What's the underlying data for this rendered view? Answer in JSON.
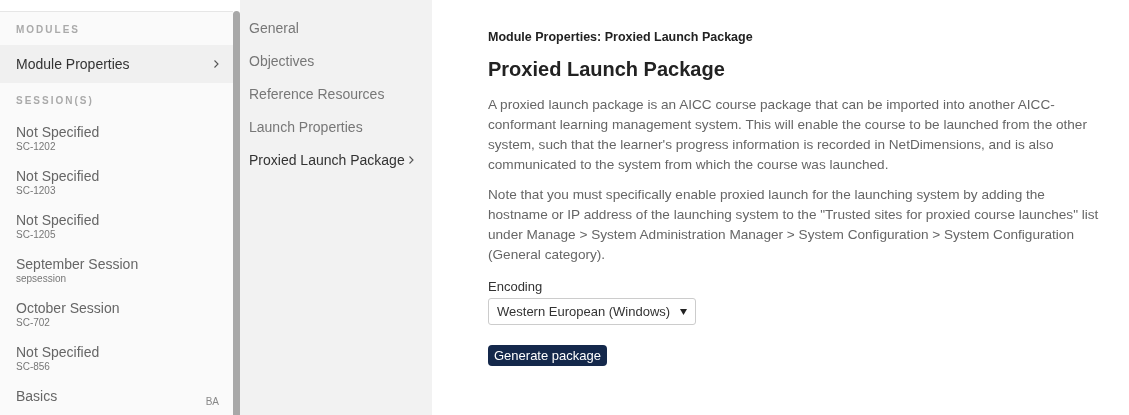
{
  "sidebar": {
    "sections": [
      {
        "heading": "MODULES",
        "items": [
          {
            "title": "Module Properties",
            "selected": true
          }
        ]
      },
      {
        "heading": "SESSION(S)",
        "items": [
          {
            "title": "Not Specified",
            "code": "SC-1202",
            "selected": false
          },
          {
            "title": "Not Specified",
            "code": "SC-1203",
            "selected": false
          },
          {
            "title": "Not Specified",
            "code": "SC-1205",
            "selected": false
          },
          {
            "title": "September Session",
            "code": "sepsession",
            "selected": false
          },
          {
            "title": "October Session",
            "code": "SC-702",
            "selected": false
          },
          {
            "title": "Not Specified",
            "code": "SC-856",
            "selected": false
          },
          {
            "title": "Basics",
            "badge": "BA",
            "selected": false
          }
        ]
      }
    ]
  },
  "nav": {
    "items": [
      {
        "label": "General",
        "selected": false
      },
      {
        "label": "Objectives",
        "selected": false
      },
      {
        "label": "Reference Resources",
        "selected": false
      },
      {
        "label": "Launch Properties",
        "selected": false
      },
      {
        "label": "Proxied Launch Package",
        "selected": true
      }
    ]
  },
  "content": {
    "breadcrumb": "Module Properties: Proxied Launch Package",
    "title": "Proxied Launch Package",
    "paragraphs": [
      "A proxied launch package is an AICC course package that can be imported into another AICC-conformant learning management system. This will enable the course to be launched from the other system, such that the learner's progress information is recorded in NetDimensions, and is also communicated to the system from which the course was launched.",
      "Note that you must specifically enable proxied launch for the launching system by adding the hostname or IP address of the launching system to the \"Trusted sites for proxied course launches\" list under Manage > System Administration Manager > System Configuration > System Configuration (General category)."
    ],
    "encoding": {
      "label": "Encoding",
      "value": "Western European (Windows)"
    },
    "button": "Generate package"
  }
}
